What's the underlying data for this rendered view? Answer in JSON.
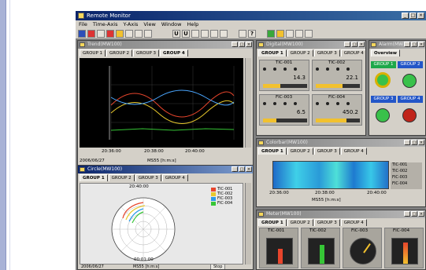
{
  "app": {
    "title": "Remote Monitor",
    "menu": [
      "File",
      "Time-Axis",
      "Y-Axis",
      "View",
      "Window",
      "Help"
    ],
    "toolbar_letters": [
      "U",
      "U",
      "?"
    ]
  },
  "trend_window": {
    "title": "Trend(MW100)",
    "tabs": [
      "GROUP 1",
      "GROUP 2",
      "GROUP 3",
      "GROUP 4"
    ],
    "time_ticks": [
      "20:36:00",
      "20:38:00",
      "20:40:00"
    ],
    "date": "2006/06/27",
    "scale_label": "MS55 [h:m:s]"
  },
  "digital_window": {
    "title": "Digital(MW100)",
    "tabs": [
      "GROUP 1",
      "GROUP 2",
      "GROUP 3",
      "GROUP 4"
    ],
    "panels": [
      {
        "tag": "TIC-001",
        "value": "14.3"
      },
      {
        "tag": "TIC-002",
        "value": "22.1"
      },
      {
        "tag": "FIC-003",
        "value": "6.5"
      },
      {
        "tag": "FIC-004",
        "value": "450.2"
      }
    ]
  },
  "alarm_window": {
    "title": "Alarm(MW100)",
    "tab": "Overview",
    "groups": [
      "GROUP 1",
      "GROUP 2",
      "GROUP 3",
      "GROUP 4"
    ]
  },
  "colorbar_window": {
    "title": "Colorbar(MW100)",
    "tabs": [
      "GROUP 1",
      "GROUP 2",
      "GROUP 3",
      "GROUP 4"
    ],
    "time_ticks": [
      "20:36:00",
      "20:38:00",
      "20:40:00"
    ],
    "scale_label": "MS55 [h:m:s]",
    "legend": [
      "TIC-001",
      "TIC-002",
      "FIC-003",
      "FIC-004"
    ]
  },
  "circle_window": {
    "title": "Circle(MW100)",
    "tabs": [
      "GROUP 1",
      "GROUP 2",
      "GROUP 3",
      "GROUP 4"
    ],
    "top_time": "20:40:00",
    "bottom_time": "00:01:00",
    "legend": [
      "TIC-001",
      "TIC-002",
      "FIC-003",
      "FIC-004"
    ],
    "legend_colors": [
      "#e8452c",
      "#e8c82c",
      "#2c9ae8",
      "#36c636"
    ],
    "date": "2006/06/27",
    "scale_label": "MS55 [h:m:s]",
    "button": "Stop"
  },
  "meter_window": {
    "title": "Meter(MW100)",
    "tabs": [
      "GROUP 1",
      "GROUP 2",
      "GROUP 3",
      "GROUP 4"
    ],
    "tags": [
      "TIC-001",
      "TIC-002",
      "FIC-003",
      "FIC-004"
    ]
  },
  "colors": {
    "trend_bg": "#000000",
    "title_active": "#0a246a",
    "face": "#d4d0c8"
  }
}
